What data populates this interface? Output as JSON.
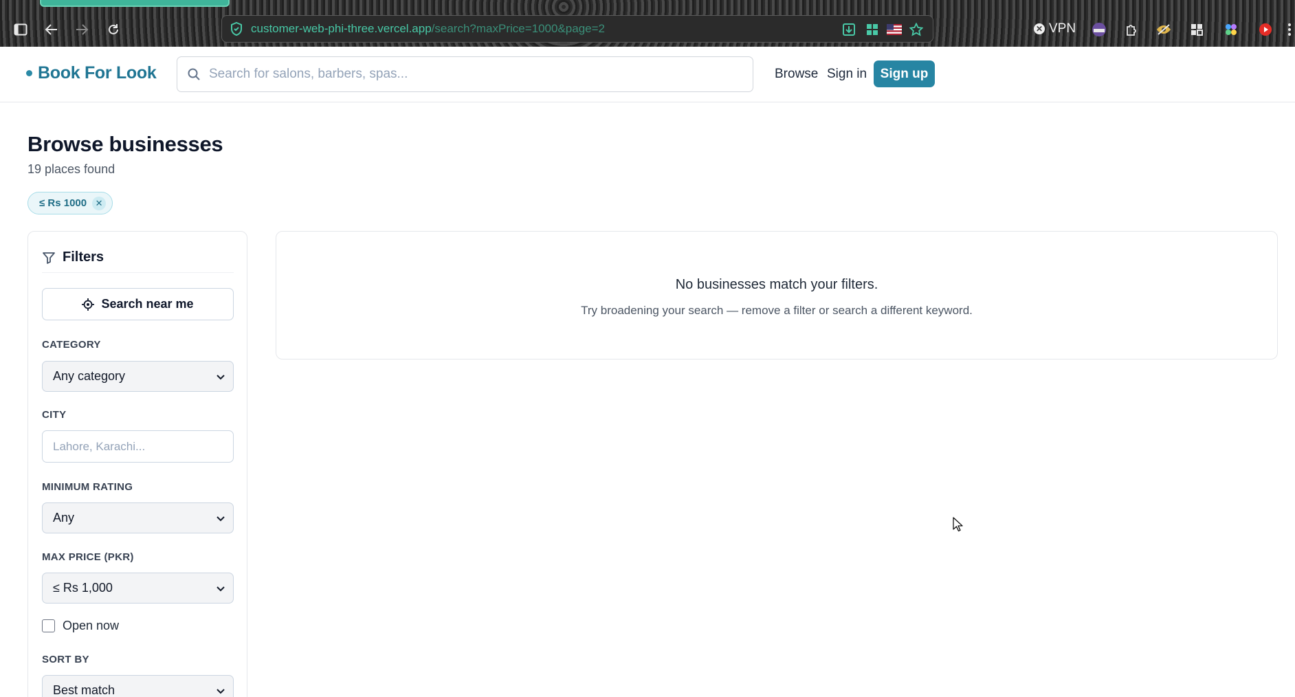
{
  "browser": {
    "url_host": "customer-web-phi-three.vercel.app",
    "url_path": "/search?maxPrice=1000&page=2",
    "vpn_label": "VPN"
  },
  "header": {
    "brand": "Book For Look",
    "search_placeholder": "Search for salons, barbers, spas...",
    "nav_browse": "Browse",
    "nav_signin": "Sign in",
    "nav_signup": "Sign up"
  },
  "page": {
    "title": "Browse businesses",
    "count": "19 places found",
    "active_chip": "≤ Rs 1000"
  },
  "filters": {
    "title": "Filters",
    "near_me": "Search near me",
    "category_label": "CATEGORY",
    "category_value": "Any category",
    "city_label": "CITY",
    "city_placeholder": "Lahore, Karachi...",
    "rating_label": "MINIMUM RATING",
    "rating_value": "Any",
    "price_label": "MAX PRICE (PKR)",
    "price_value": "≤ Rs 1,000",
    "open_now": "Open now",
    "sort_label": "SORT BY",
    "sort_value": "Best match"
  },
  "results": {
    "empty_title": "No businesses match your filters.",
    "empty_sub": "Try broadening your search — remove a filter or search a different keyword."
  },
  "colors": {
    "brand": "#1f7593",
    "signup_bg": "#2785a3",
    "chip_bg": "#eaf6f9"
  }
}
